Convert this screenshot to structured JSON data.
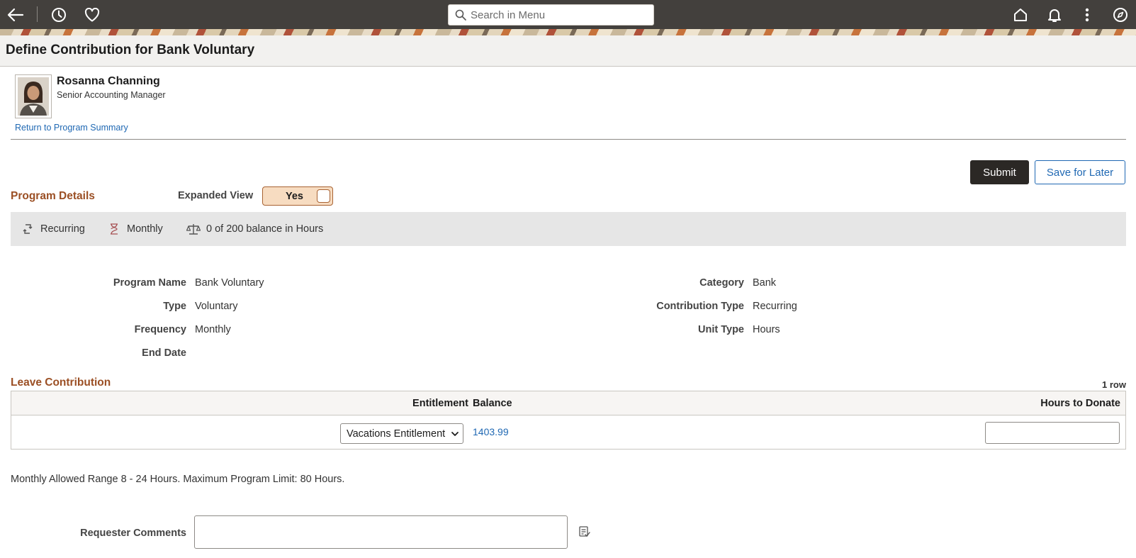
{
  "topbar": {
    "search_placeholder": "Search in Menu",
    "icons": [
      "back-icon",
      "history-icon",
      "favorites-icon",
      "search-icon",
      "home-icon",
      "notifications-icon",
      "more-actions-icon",
      "navigator-icon"
    ]
  },
  "page": {
    "title": "Define Contribution for Bank Voluntary"
  },
  "employee": {
    "name": "Rosanna Channing",
    "job_title": "Senior Accounting Manager",
    "return_link": "Return to Program Summary"
  },
  "actions": {
    "submit": "Submit",
    "save_for_later": "Save for Later"
  },
  "program_details": {
    "section_title": "Program Details",
    "expanded_view_label": "Expanded View",
    "expanded_view_value": "Yes",
    "summary": {
      "recurrence": "Recurring",
      "frequency": "Monthly",
      "balance": "0 of 200 balance in Hours"
    },
    "fields": {
      "program_name_label": "Program Name",
      "program_name": "Bank Voluntary",
      "type_label": "Type",
      "type": "Voluntary",
      "frequency_label": "Frequency",
      "frequency": "Monthly",
      "end_date_label": "End Date",
      "end_date": "",
      "category_label": "Category",
      "category": "Bank",
      "contribution_type_label": "Contribution Type",
      "contribution_type": "Recurring",
      "unit_type_label": "Unit Type",
      "unit_type": "Hours"
    }
  },
  "leave_contribution": {
    "section_title": "Leave Contribution",
    "row_count": "1 row",
    "columns": {
      "entitlement": "Entitlement",
      "balance": "Balance",
      "hours_to_donate": "Hours to Donate"
    },
    "rows": [
      {
        "entitlement": "Vacations Entitlement",
        "balance": "1403.99",
        "hours_to_donate": ""
      }
    ]
  },
  "note": "Monthly Allowed Range 8 - 24 Hours. Maximum Program Limit: 80 Hours.",
  "comments": {
    "label": "Requester Comments",
    "value": ""
  },
  "colors": {
    "topbar": "#43403d",
    "accent": "#9b4f24",
    "link": "#1f68b3",
    "primary_button": "#2b2825",
    "toggle_bg": "#f7dcc1"
  }
}
